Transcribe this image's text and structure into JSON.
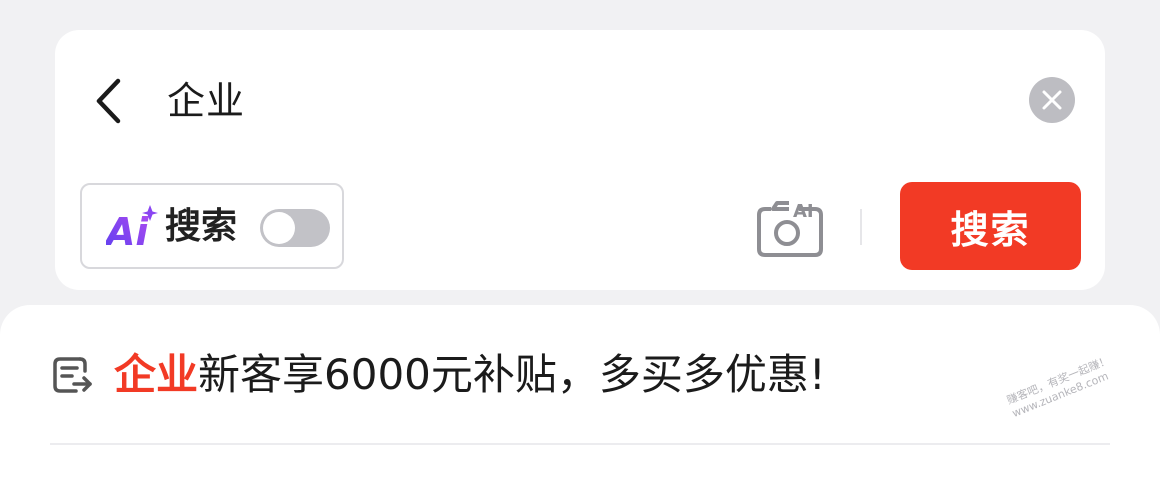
{
  "search": {
    "query": "企业",
    "ai_chip_label": "搜索",
    "ai_logo_text": "Ai",
    "camera_badge": "AI",
    "search_button_label": "搜索",
    "ai_toggle_on": false
  },
  "suggestion": {
    "highlight": "企业",
    "rest": "新客享6000元补贴，多买多优惠!"
  },
  "watermark": {
    "line1": "赚客吧，有奖一起赚！",
    "line2": "www.zuanke8.com"
  },
  "colors": {
    "accent_red": "#f23a25",
    "ai_purple": "#7a3cf0",
    "clear_gray": "#bdbdc2",
    "toggle_off": "#c2c2c7",
    "background": "#f1f1f3"
  },
  "icons": {
    "back": "chevron-left-icon",
    "clear": "close-icon",
    "ai_logo": "ai-sparkle-icon",
    "camera": "camera-ai-icon",
    "suggestion": "suggest-arrow-icon"
  }
}
